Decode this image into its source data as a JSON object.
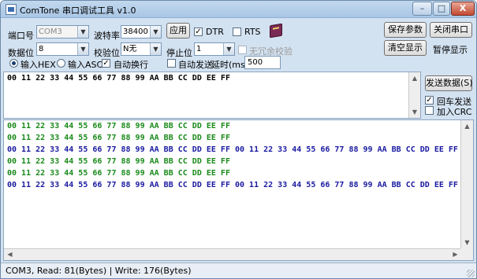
{
  "window": {
    "title": "ComTone 串口调试工具 v1.0",
    "minimize_label": "–",
    "maximize_label": "□",
    "close_label": "X"
  },
  "controls": {
    "port_label": "端口号",
    "port_value": "COM3",
    "baud_label": "波特率",
    "baud_value": "38400",
    "apply_label": "应用",
    "dtr_label": "DTR",
    "dtr_checked": true,
    "rts_label": "RTS",
    "rts_checked": false,
    "databits_label": "数据位",
    "databits_value": "8",
    "parity_label": "校验位",
    "parity_value": "N无",
    "stopbits_label": "停止位",
    "stopbits_value": "1",
    "redundant_label": "无冗余校验",
    "input_hex_label": "输入HEX",
    "input_asc_label": "输入ASC",
    "autowrap_label": "自动换行",
    "autosend_label": "自动发送",
    "delay_label": "延时(ms):",
    "delay_value": "500",
    "save_params_label": "保存参数",
    "close_port_label": "关闭串口",
    "clear_display_label": "清空显示",
    "pause_display_label": "暂停显示",
    "send_data_label": "发送数据(S)",
    "enter_send_label": "回车发送",
    "add_crc_label": "加入CRC",
    "book_icon": "book-icon"
  },
  "send_area": {
    "text": "00 11 22 33 44 55 66 77 88 99 AA BB CC DD EE FF"
  },
  "receive_area": {
    "lines": [
      {
        "text": "00 11 22 33 44 55 66 77 88 99 AA BB CC DD EE FF",
        "color": "#1a8a1a"
      },
      {
        "text": "00 11 22 33 44 55 66 77 88 99 AA BB CC DD EE FF",
        "color": "#1a8a1a"
      },
      {
        "text": "00 11 22 33 44 55 66 77 88 99 AA BB CC DD EE FF 00 11 22 33 44 55 66 77 88 99 AA BB CC DD EE FF",
        "color": "#1a1aa0"
      },
      {
        "text": "00 11 22 33 44 55 66 77 88 99 AA BB CC DD EE FF",
        "color": "#1a8a1a"
      },
      {
        "text": "00 11 22 33 44 55 66 77 88 99 AA BB CC DD EE FF",
        "color": "#1a8a1a"
      },
      {
        "text": "00 11 22 33 44 55 66 77 88 99 AA BB CC DD EE FF 00 11 22 33 44 55 66 77 88 99 AA BB CC DD EE FF",
        "color": "#1a1aa0"
      }
    ]
  },
  "status": {
    "text": "COM3, Read: 81(Bytes) | Write: 176(Bytes)"
  }
}
